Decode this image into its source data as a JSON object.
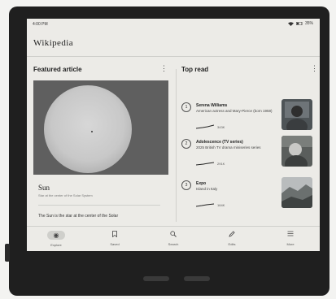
{
  "status": {
    "time": "4:00 PM",
    "battery": "35%"
  },
  "app": {
    "logo": "Wikipedia"
  },
  "featured": {
    "heading": "Featured article",
    "title": "Sun",
    "subtitle": "Star at the center of the Solar System",
    "excerpt": "The Sun is the star at the center of the Solar"
  },
  "top_read": {
    "heading": "Top read",
    "items": [
      {
        "rank": "1",
        "title": "Serena Williams",
        "desc": "American actress and Mary-Pierce (born 1958)",
        "views": "343K"
      },
      {
        "rank": "2",
        "title": "Adolescence (TV series)",
        "desc": "2025 British TV drama miniseries series",
        "views": "291K"
      },
      {
        "rank": "3",
        "title": "Expo",
        "desc": "Island in Italy",
        "views": "164K"
      }
    ]
  },
  "nav": {
    "items": [
      {
        "label": "Explore",
        "icon": "explore-icon"
      },
      {
        "label": "Saved",
        "icon": "bookmark-icon"
      },
      {
        "label": "Search",
        "icon": "search-icon"
      },
      {
        "label": "Edits",
        "icon": "pencil-icon"
      },
      {
        "label": "More",
        "icon": "menu-icon"
      }
    ]
  }
}
